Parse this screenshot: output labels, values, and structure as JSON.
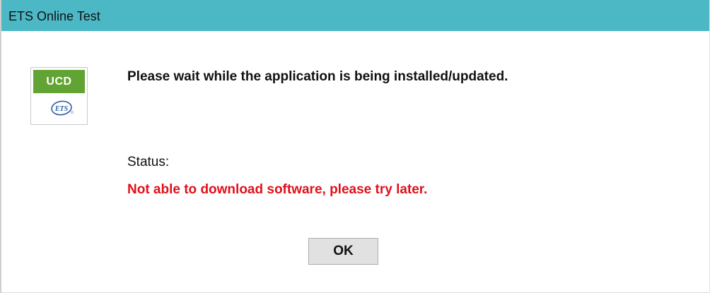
{
  "window": {
    "title": "ETS Online Test",
    "title_bar_color": "#4cb8c6"
  },
  "logo": {
    "badge_text": "UCD",
    "badge_color": "#62a434",
    "brand_text": "ETS",
    "icon": "ets-logo-icon"
  },
  "content": {
    "message": "Please wait while the application is being installed/updated.",
    "status_label": "Status:",
    "status_value": "Not able to download software, please try later.",
    "status_color": "#e0101a"
  },
  "buttons": {
    "ok_label": "OK"
  }
}
